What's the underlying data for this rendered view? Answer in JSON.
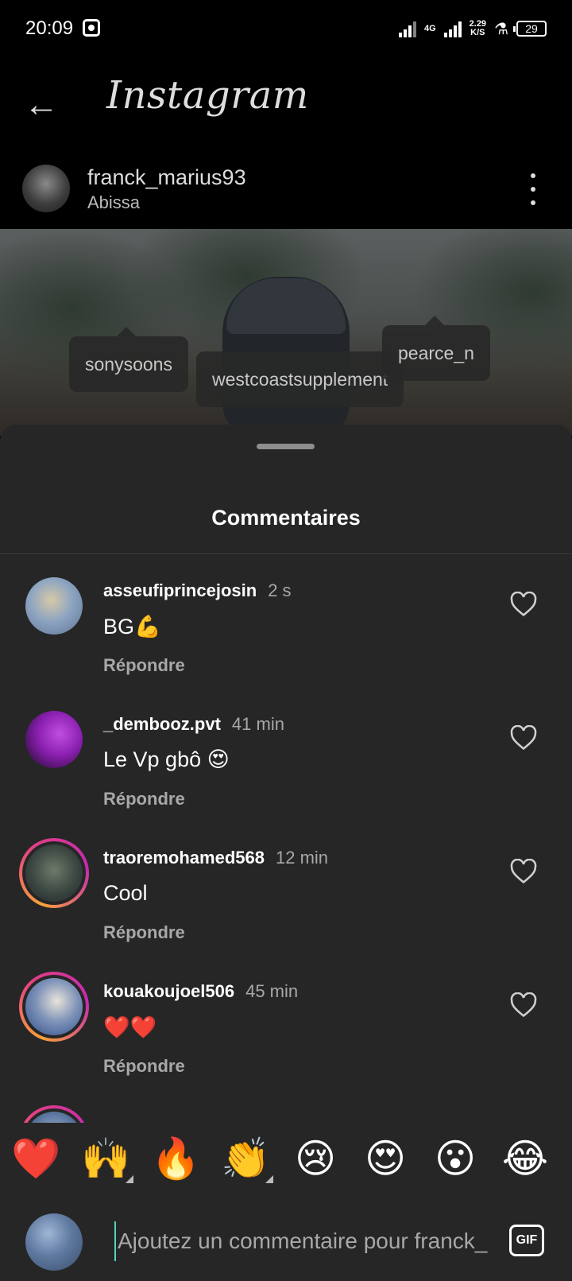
{
  "status_bar": {
    "time": "20:09",
    "network": "4G",
    "speed_value": "2.29",
    "speed_unit": "K/S",
    "battery": "29"
  },
  "app_bar": {
    "brand": "Instagram"
  },
  "post": {
    "username": "franck_marius93",
    "location": "Abissa",
    "tags": [
      "sonysoons",
      "westcoastsupplement",
      "pearce_n"
    ]
  },
  "comments_sheet": {
    "title": "Commentaires",
    "comments": [
      {
        "username": "asseufiprincejosin",
        "time": "2 s",
        "text": "BG💪",
        "reply": "Répondre"
      },
      {
        "username": "_dembooz.pvt",
        "time": "41 min",
        "text": "Le Vp gbô 😍",
        "reply": "Répondre"
      },
      {
        "username": "traoremohamed568",
        "time": "12 min",
        "text": "Cool",
        "reply": "Répondre"
      },
      {
        "username": "kouakoujoel506",
        "time": "45 min",
        "text": "❤️❤️",
        "reply": "Répondre"
      }
    ]
  },
  "quick_reactions": [
    "❤️",
    "🙌",
    "🔥",
    "👏",
    "😢",
    "😍",
    "😮",
    "😂"
  ],
  "composer": {
    "placeholder": "Ajoutez un commentaire pour franck_",
    "gif_label": "GIF"
  },
  "colors": {
    "background": "#000000",
    "sheet": "#262626",
    "secondary_text": "#a8a8a8",
    "story_ring_start": "#f9a13a",
    "story_ring_end": "#c22bb0"
  }
}
